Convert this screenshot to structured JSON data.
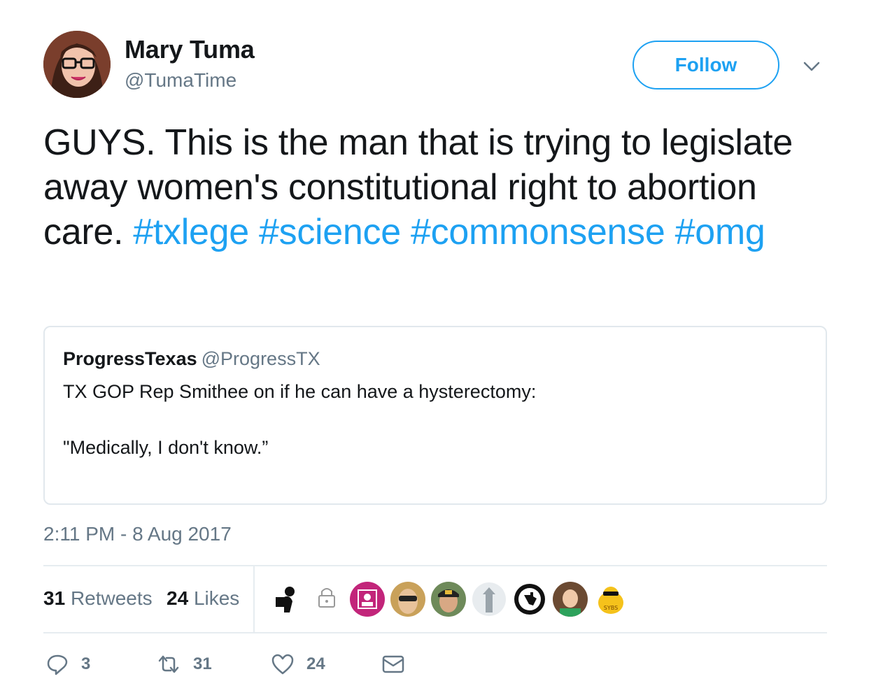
{
  "user": {
    "name": "Mary Tuma",
    "handle": "@TumaTime"
  },
  "follow_label": "Follow",
  "tweet": {
    "text_plain": "GUYS. This is the man that is trying to legislate away women's constitutional right to abortion care.",
    "hashtags": [
      "#txlege",
      "#science",
      "#commonsense",
      "#omg"
    ]
  },
  "quote": {
    "name": "ProgressTexas",
    "handle": "@ProgressTX",
    "line1": "TX GOP Rep Smithee on if he can have a hysterectomy:",
    "line2": "\"Medically, I don't know.”"
  },
  "timestamp": "2:11 PM - 8 Aug 2017",
  "stats": {
    "retweets_count": "31",
    "retweets_label": "Retweets",
    "likes_count": "24",
    "likes_label": "Likes"
  },
  "likers": [
    "user-avatar-1",
    "user-avatar-2",
    "user-avatar-3",
    "user-avatar-4",
    "user-avatar-5",
    "user-avatar-6",
    "user-avatar-7",
    "user-avatar-8",
    "user-avatar-9"
  ],
  "likers_badge_text": "SYBS",
  "actions": {
    "reply_count": "3",
    "retweet_count": "31",
    "like_count": "24"
  },
  "colors": {
    "accent": "#1da1f2",
    "muted": "#657786",
    "text": "#14171a",
    "border": "#e1e8ed"
  }
}
